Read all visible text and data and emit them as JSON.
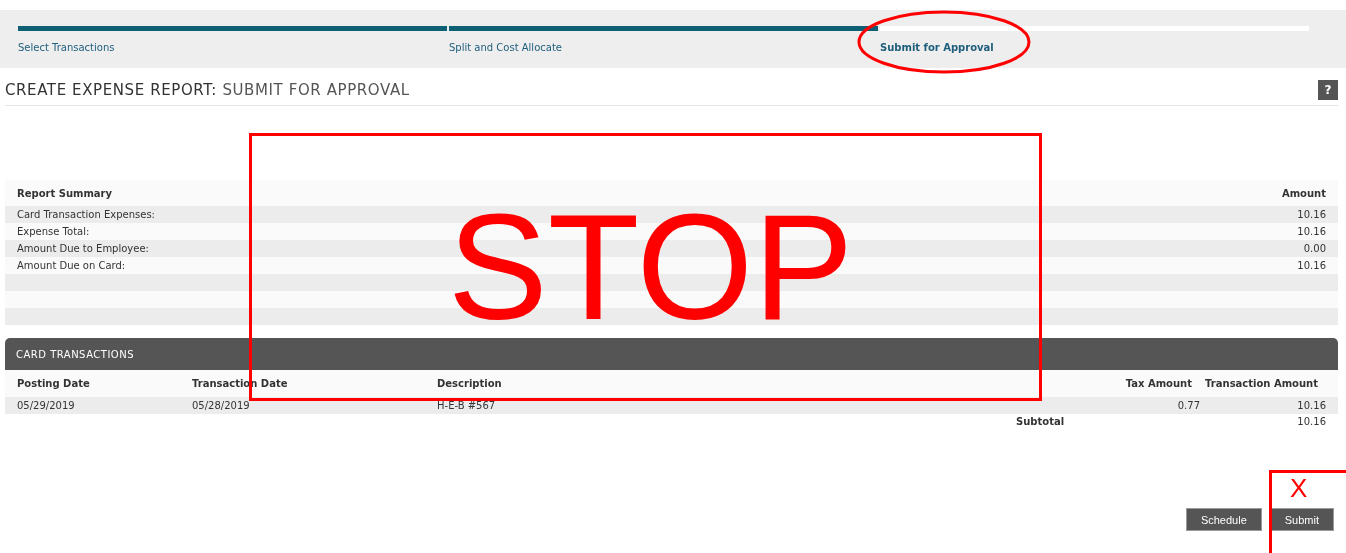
{
  "steps": [
    {
      "label": "Select Transactions",
      "completed": true,
      "selected": false
    },
    {
      "label": "Split and Cost Allocate",
      "completed": true,
      "selected": false
    },
    {
      "label": "Submit for Approval",
      "completed": false,
      "selected": true
    }
  ],
  "page_title": {
    "prefix": "CREATE EXPENSE REPORT:",
    "suffix": "SUBMIT FOR APPROVAL"
  },
  "help_button": "?",
  "summary": {
    "columns": [
      "Report Summary",
      "Amount"
    ],
    "rows": [
      {
        "label": "Card Transaction Expenses:",
        "amount": "10.16"
      },
      {
        "label": "Expense Total:",
        "amount": "10.16"
      },
      {
        "label": "Amount Due to Employee:",
        "amount": "0.00"
      },
      {
        "label": "Amount Due on Card:",
        "amount": "10.16"
      }
    ]
  },
  "card_transactions": {
    "title": "CARD TRANSACTIONS",
    "columns": [
      "Posting Date",
      "Transaction Date",
      "Description",
      "Tax Amount",
      "Transaction Amount"
    ],
    "rows": [
      {
        "posting_date": "05/29/2019",
        "transaction_date": "05/28/2019",
        "description": "H-E-B #567",
        "tax_amount": "0.77",
        "transaction_amount": "10.16"
      }
    ],
    "subtotal_label": "Subtotal",
    "subtotal": "10.16"
  },
  "buttons": [
    "Schedule",
    "Submit"
  ],
  "annotations": [
    {
      "kind": "ellipse"
    },
    {
      "kind": "box",
      "text": "STOP"
    },
    {
      "kind": "corner",
      "text": "X"
    }
  ]
}
